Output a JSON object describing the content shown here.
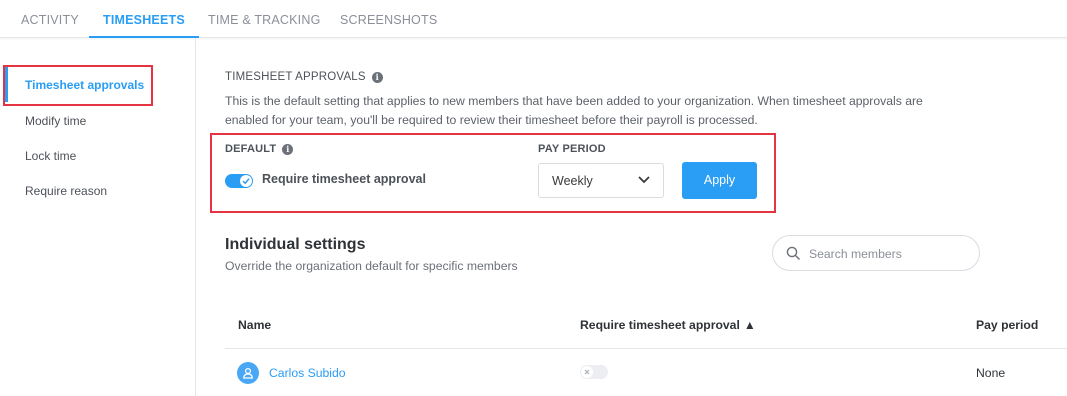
{
  "tabs": [
    {
      "label": "ACTIVITY"
    },
    {
      "label": "TIMESHEETS"
    },
    {
      "label": "TIME & TRACKING"
    },
    {
      "label": "SCREENSHOTS"
    }
  ],
  "sidebar": {
    "items": [
      {
        "label": "Timesheet approvals"
      },
      {
        "label": "Modify time"
      },
      {
        "label": "Lock time"
      },
      {
        "label": "Require reason"
      }
    ]
  },
  "section": {
    "title": "TIMESHEET APPROVALS",
    "info_icon": "info-icon",
    "description": "This is the default setting that applies to new members that have been added to your organization. When timesheet approvals are enabled for your team, you'll be required to review their timesheet before their payroll is processed."
  },
  "default": {
    "label": "DEFAULT",
    "toggle_label": "Require timesheet approval",
    "toggle_on": true
  },
  "pay_period": {
    "label": "PAY PERIOD",
    "selected": "Weekly"
  },
  "apply_label": "Apply",
  "individual": {
    "title": "Individual settings",
    "subtitle": "Override the organization default for specific members",
    "search_placeholder": "Search members"
  },
  "table": {
    "columns": [
      "Name",
      "Require timesheet approval",
      "Pay period"
    ],
    "sort_indicator": "▲",
    "rows": [
      {
        "name": "Carlos Subido",
        "require_approval": false,
        "pay_period": "None"
      }
    ]
  },
  "colors": {
    "accent": "#2a9df4",
    "highlight": "#e53341"
  }
}
